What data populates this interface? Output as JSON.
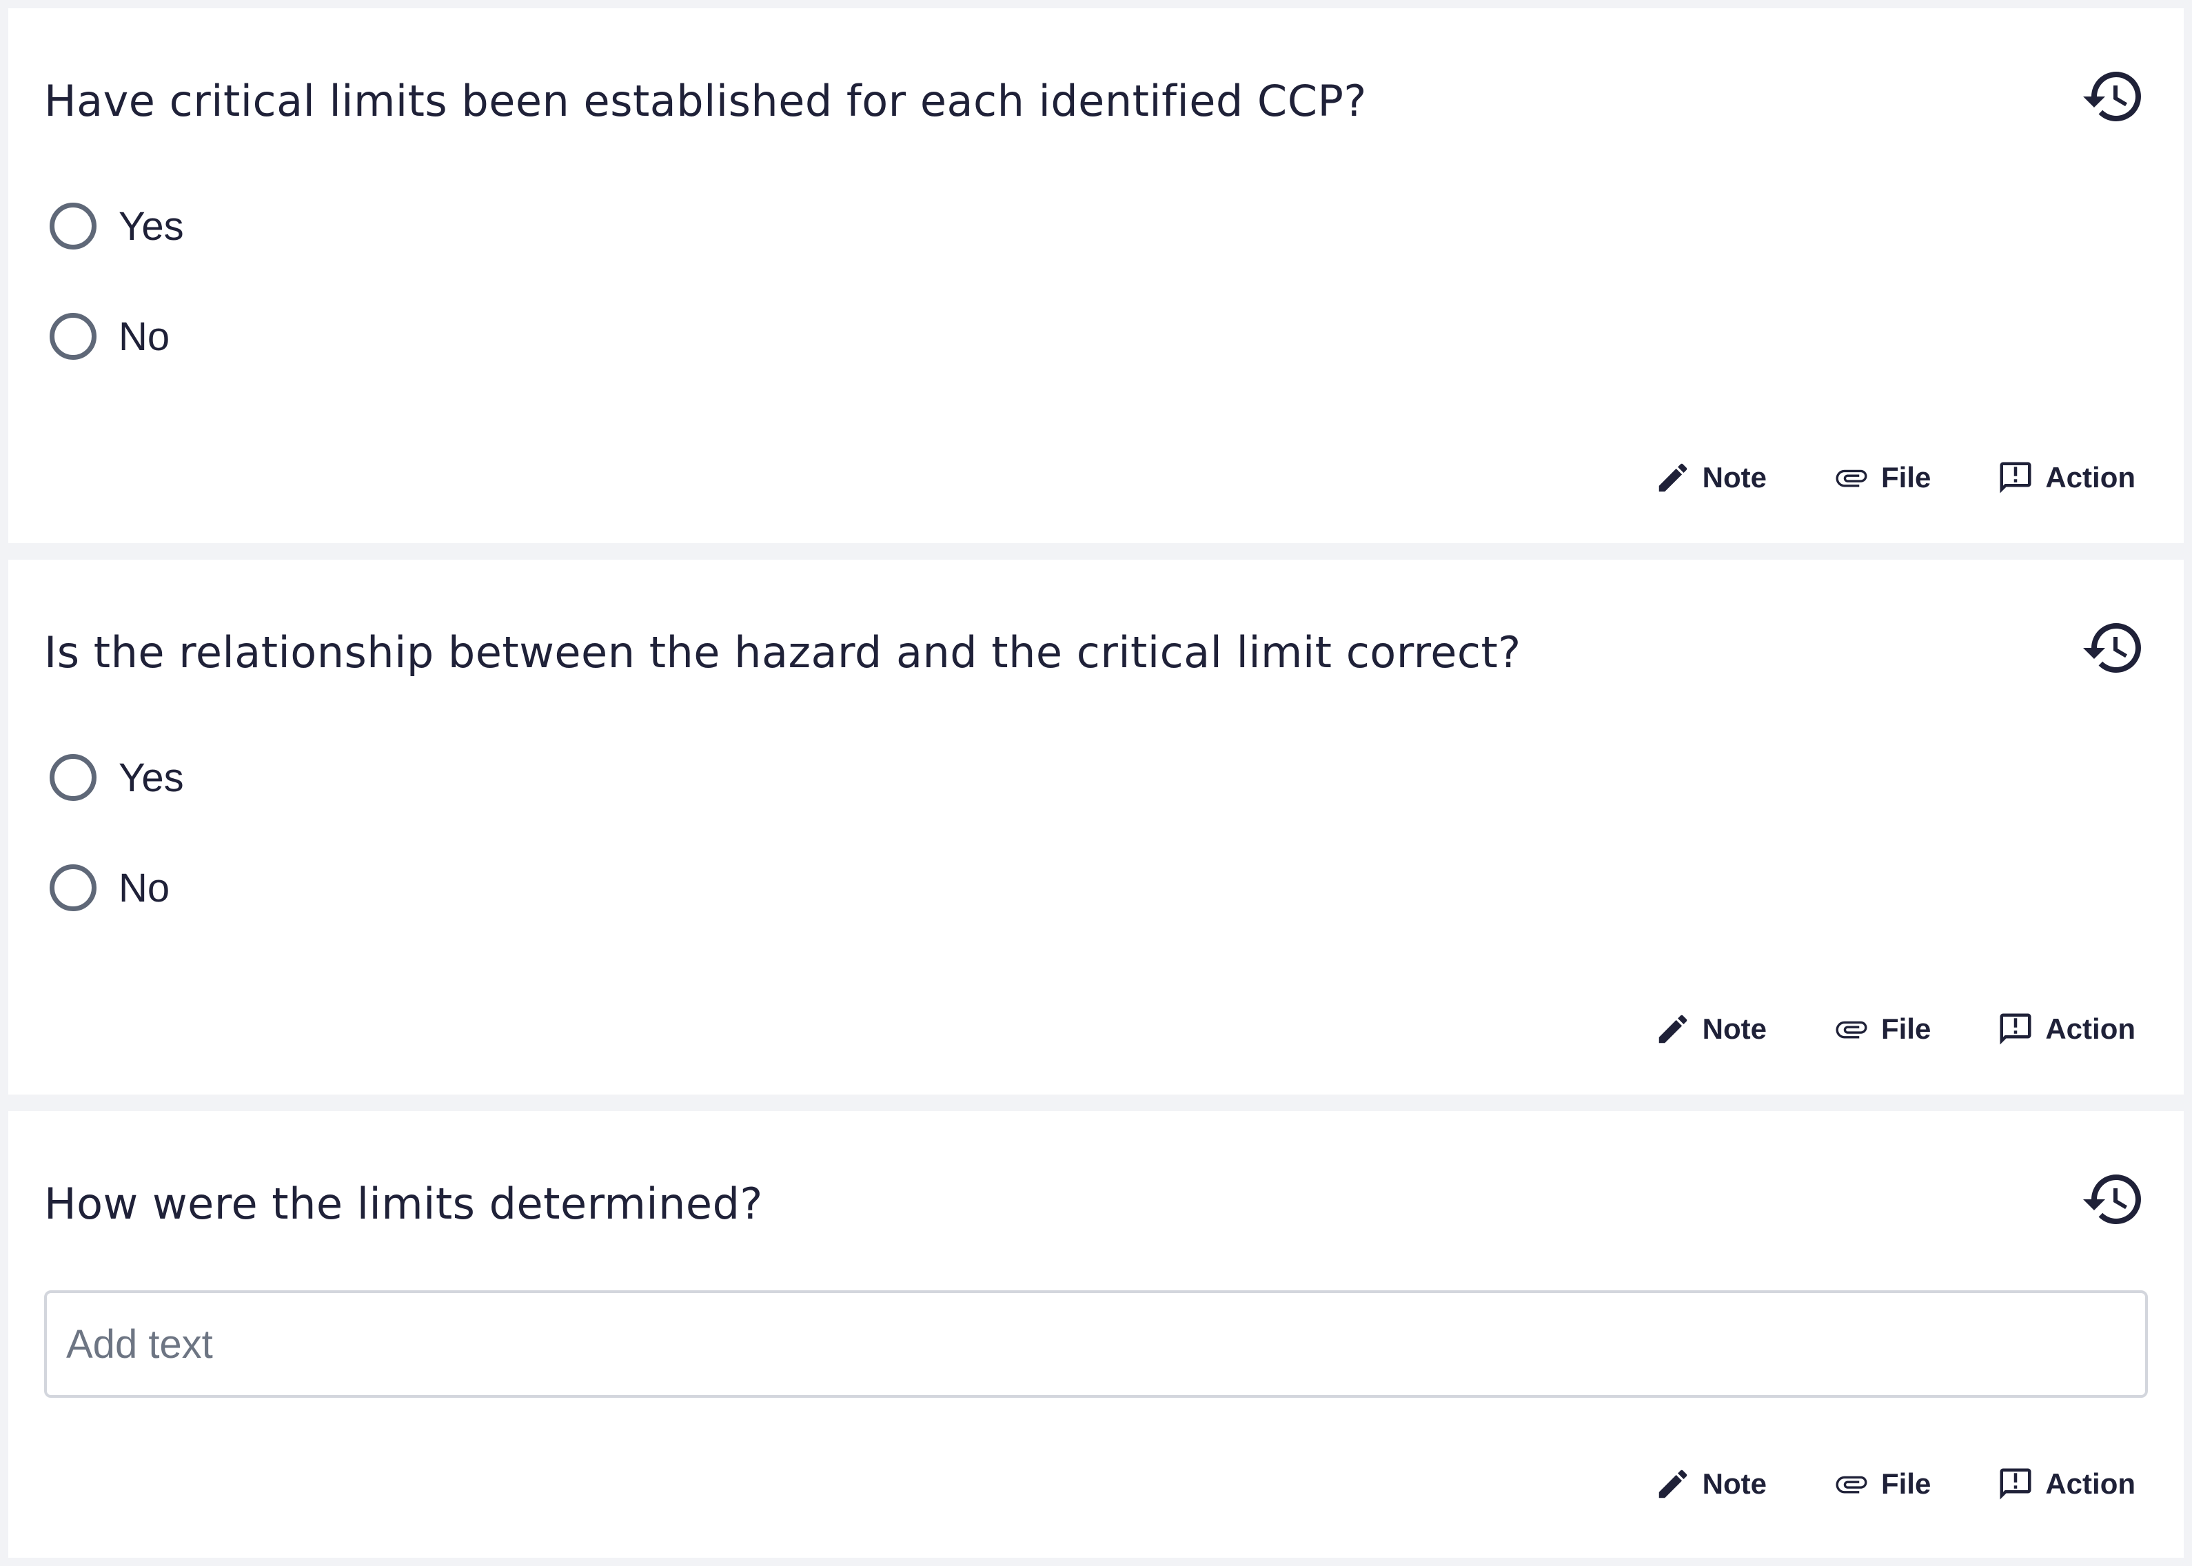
{
  "questions": [
    {
      "text": "Have critical limits been established for each identified CCP?",
      "type": "radio",
      "options": [
        "Yes",
        "No"
      ]
    },
    {
      "text": "Is the relationship between the hazard and the critical limit correct?",
      "type": "radio",
      "options": [
        "Yes",
        "No"
      ]
    },
    {
      "text": "How were the limits determined?",
      "type": "text",
      "placeholder": "Add text"
    }
  ],
  "actions": {
    "note_label": "Note",
    "file_label": "File",
    "action_label": "Action"
  },
  "icons": {
    "history": "history-icon",
    "note": "pencil-icon",
    "file": "paperclip-icon",
    "action": "report-flag-icon"
  },
  "colors": {
    "text": "#1f2138",
    "radio_border": "#5f6878",
    "background": "#f2f3f6",
    "card": "#ffffff",
    "input_border": "#d3d6dd",
    "placeholder": "#6d7583"
  }
}
